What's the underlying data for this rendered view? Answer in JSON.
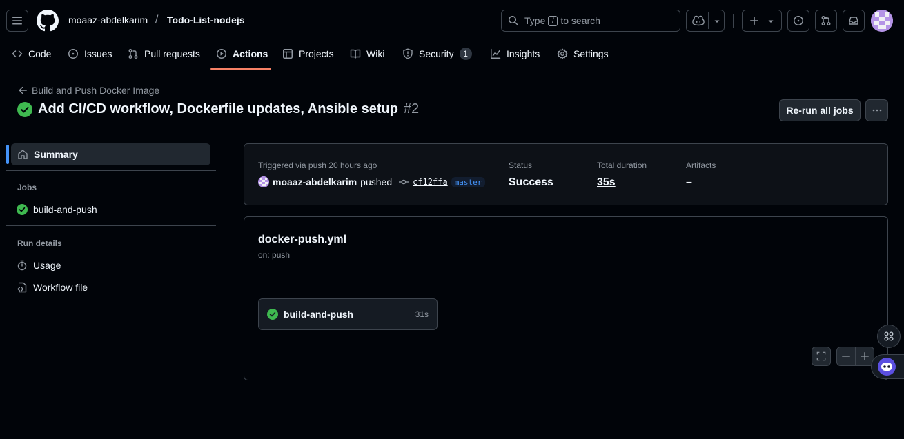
{
  "header": {
    "owner": "moaaz-abdelkarim",
    "separator": "/",
    "repo": "Todo-List-nodejs",
    "search_prefix": "Type",
    "search_key": "/",
    "search_suffix": "to search"
  },
  "nav": {
    "tabs": [
      {
        "label": "Code",
        "icon": "code-icon"
      },
      {
        "label": "Issues",
        "icon": "issue-icon"
      },
      {
        "label": "Pull requests",
        "icon": "pull-request-icon"
      },
      {
        "label": "Actions",
        "icon": "play-icon",
        "active": true
      },
      {
        "label": "Projects",
        "icon": "table-icon"
      },
      {
        "label": "Wiki",
        "icon": "book-icon"
      },
      {
        "label": "Security",
        "icon": "shield-icon",
        "count": "1"
      },
      {
        "label": "Insights",
        "icon": "graph-icon"
      },
      {
        "label": "Settings",
        "icon": "gear-icon"
      }
    ]
  },
  "run": {
    "workflow_link": "Build and Push Docker Image",
    "title": "Add CI/CD workflow, Dockerfile updates, Ansible setup",
    "number": "#2",
    "rerun_label": "Re-run all jobs"
  },
  "sidebar": {
    "summary_label": "Summary",
    "jobs_heading": "Jobs",
    "jobs": [
      {
        "label": "build-and-push"
      }
    ],
    "details_heading": "Run details",
    "details": [
      {
        "label": "Usage",
        "icon": "stopwatch-icon"
      },
      {
        "label": "Workflow file",
        "icon": "file-code-icon"
      }
    ]
  },
  "summary": {
    "trigger_text": "Triggered via push 20 hours ago",
    "actor": "moaaz-abdelkarim",
    "action": "pushed",
    "commit_sha": "cf12ffa",
    "branch": "master",
    "status_label": "Status",
    "status_value": "Success",
    "duration_label": "Total duration",
    "duration_value": "35s",
    "artifacts_label": "Artifacts",
    "artifacts_value": "–"
  },
  "graph": {
    "workflow_file": "docker-push.yml",
    "trigger": "on: push",
    "job_name": "build-and-push",
    "job_duration": "31s"
  },
  "colors": {
    "background": "#010409",
    "border": "#3d444d",
    "success": "#3fb950",
    "accent_underline": "#f78166",
    "link_blue": "#4493f8"
  }
}
